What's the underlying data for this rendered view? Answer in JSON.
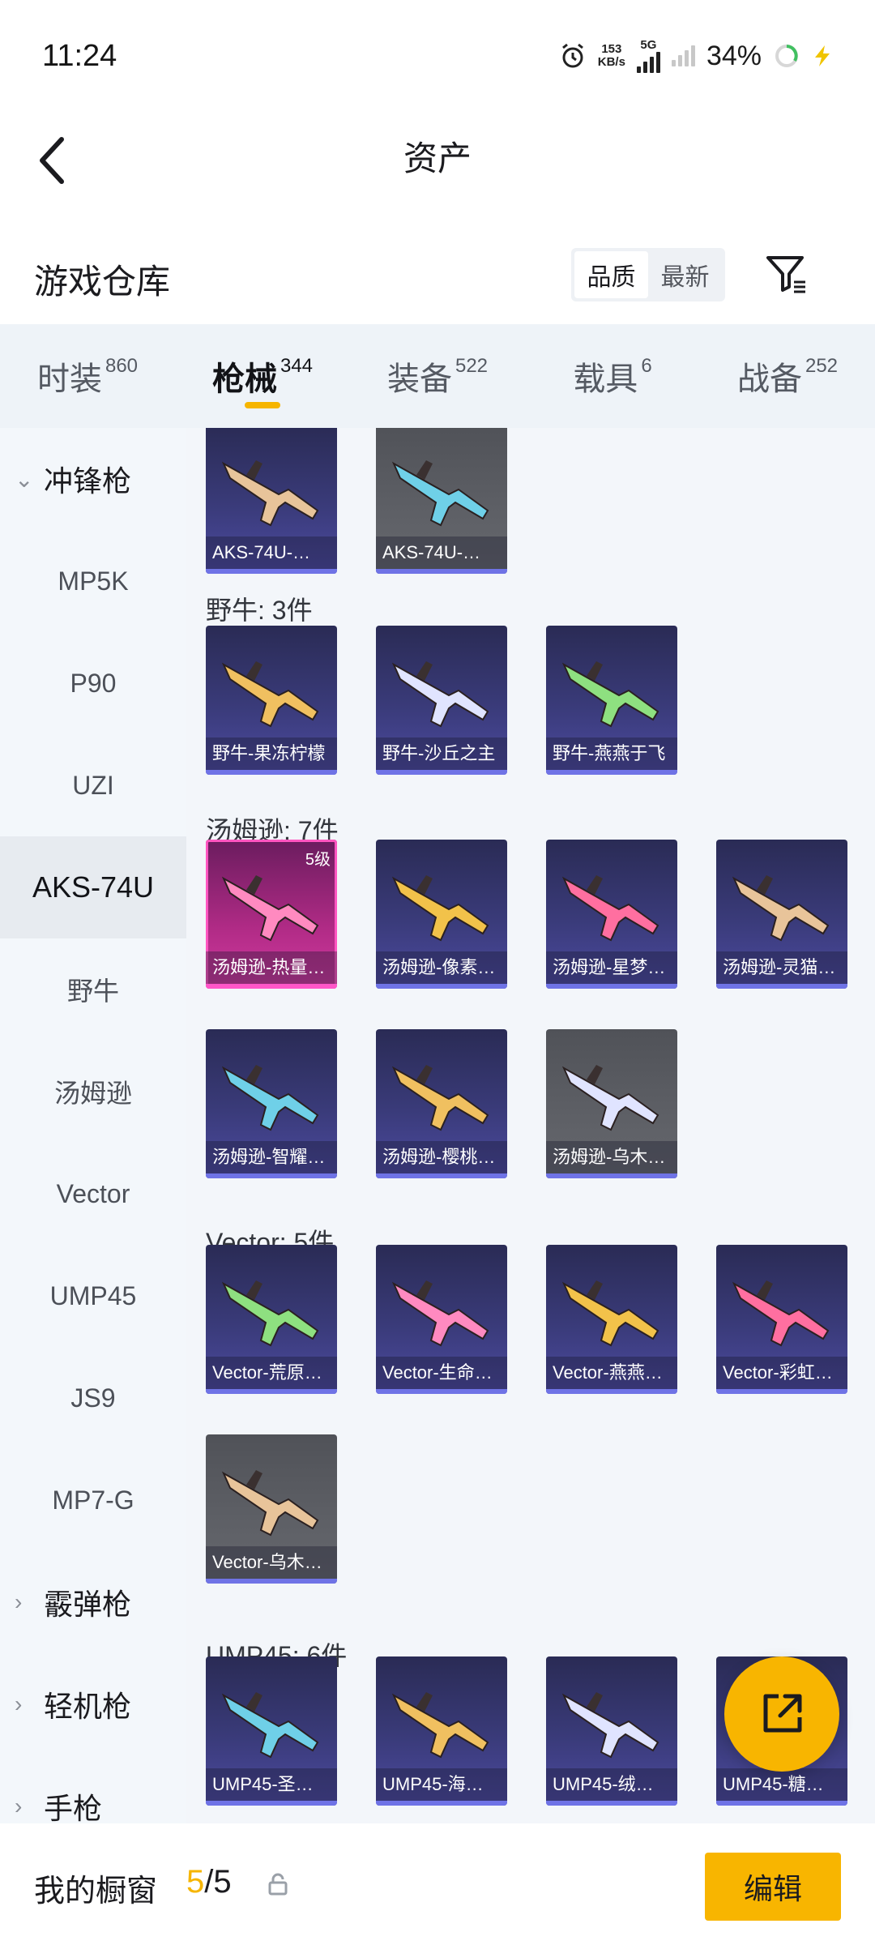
{
  "status_bar": {
    "time": "11:24",
    "net_speed": "153",
    "net_unit": "KB/s",
    "network": "5G",
    "battery": "34%"
  },
  "header": {
    "title": "资产"
  },
  "section": {
    "title": "游戏仓库",
    "sort_options": [
      "品质",
      "最新"
    ],
    "sort_selected": "品质"
  },
  "tabs": [
    {
      "label": "时装",
      "count": "860"
    },
    {
      "label": "枪械",
      "count": "344",
      "active": true
    },
    {
      "label": "装备",
      "count": "522"
    },
    {
      "label": "载具",
      "count": "6"
    },
    {
      "label": "战备",
      "count": "252"
    }
  ],
  "sidebar": {
    "group_open": "冲锋枪",
    "items": [
      "MP5K",
      "P90",
      "UZI",
      "AKS-74U",
      "野牛",
      "汤姆逊",
      "Vector",
      "UMP45",
      "JS9",
      "MP7-G"
    ],
    "active_item": "AKS-74U",
    "collapsed_groups": [
      "霰弹枪",
      "轻机枪",
      "手枪"
    ]
  },
  "content": {
    "aks_cards": [
      {
        "name": "AKS-74U-…",
        "style": "purple"
      },
      {
        "name": "AKS-74U-…",
        "style": "gray"
      }
    ],
    "bison_title": "野牛: 3件",
    "bison_cards": [
      {
        "name": "野牛-果冻柠檬",
        "style": "purple"
      },
      {
        "name": "野牛-沙丘之主",
        "style": "purple"
      },
      {
        "name": "野牛-燕燕于飞",
        "style": "purple"
      }
    ],
    "thompson_title": "汤姆逊: 7件",
    "thompson_cards": [
      {
        "name": "汤姆逊-热量…",
        "style": "pink",
        "level": "5级"
      },
      {
        "name": "汤姆逊-像素…",
        "style": "purple"
      },
      {
        "name": "汤姆逊-星梦…",
        "style": "purple"
      },
      {
        "name": "汤姆逊-灵猫…",
        "style": "purple"
      },
      {
        "name": "汤姆逊-智耀…",
        "style": "purple"
      },
      {
        "name": "汤姆逊-樱桃…",
        "style": "purple"
      },
      {
        "name": "汤姆逊-乌木…",
        "style": "gray"
      }
    ],
    "vector_title": "Vector: 5件",
    "vector_cards": [
      {
        "name": "Vector-荒原…",
        "style": "purple"
      },
      {
        "name": "Vector-生命…",
        "style": "purple"
      },
      {
        "name": "Vector-燕燕…",
        "style": "purple"
      },
      {
        "name": "Vector-彩虹…",
        "style": "purple"
      },
      {
        "name": "Vector-乌木…",
        "style": "gray"
      }
    ],
    "ump_title": "UMP45: 6件",
    "ump_cards": [
      {
        "name": "UMP45-圣…",
        "style": "purple"
      },
      {
        "name": "UMP45-海…",
        "style": "purple"
      },
      {
        "name": "UMP45-绒…",
        "style": "purple"
      },
      {
        "name": "UMP45-糖…",
        "style": "purple"
      }
    ]
  },
  "bottom_bar": {
    "title": "我的橱窗",
    "count_current": "5",
    "count_sep": "/",
    "count_total": "5",
    "edit_label": "编辑"
  },
  "colors": {
    "accent": "#f8b500",
    "card_purple": "#3a3b7a",
    "card_gray": "#5e6066",
    "card_pink": "#b12b86"
  },
  "icons": {
    "back": "chevron-left-icon",
    "filter": "filter-icon",
    "share": "share-external-icon",
    "lock": "lock-icon",
    "alarm": "alarm-icon"
  }
}
